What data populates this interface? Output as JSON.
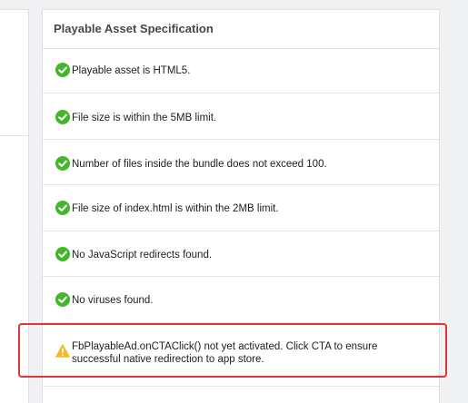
{
  "card": {
    "title": "Playable Asset Specification"
  },
  "checks": [
    {
      "status": "pass",
      "text": "Playable asset is HTML5."
    },
    {
      "status": "pass",
      "text": "File size is within the 5MB limit."
    },
    {
      "status": "pass",
      "text": "Number of files inside the bundle does not exceed 100."
    },
    {
      "status": "pass",
      "text": "File size of index.html is within the 2MB limit."
    },
    {
      "status": "pass",
      "text": "No JavaScript redirects found."
    },
    {
      "status": "pass",
      "text": "No viruses found."
    },
    {
      "status": "warning",
      "text": "FbPlayableAd.onCTAClick() not yet activated. Click CTA to ensure successful native redirection to app store."
    }
  ],
  "colors": {
    "pass": "#42b72a",
    "warning": "#f7b928",
    "highlight": "#e0343a"
  },
  "icons": {
    "pass": "check-circle-icon",
    "warning": "warning-triangle-icon"
  }
}
